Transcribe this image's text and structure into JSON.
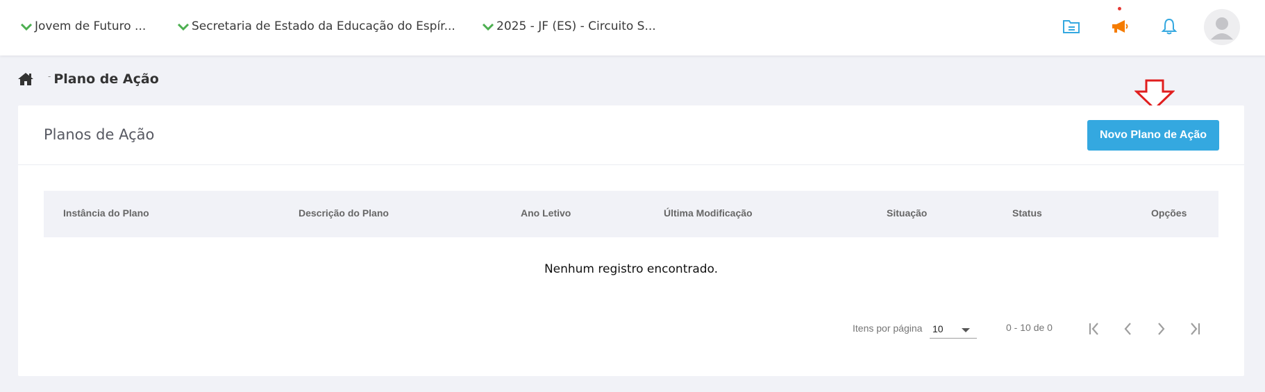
{
  "topbar": {
    "contexts": [
      {
        "label": "Jovem de Futuro ..."
      },
      {
        "label": "Secretaria de Estado da Educação do Espír..."
      },
      {
        "label": "2025 - JF (ES) - Circuito S..."
      }
    ],
    "icons": [
      "folder-icon",
      "megaphone-icon",
      "bell-icon",
      "avatar"
    ]
  },
  "breadcrumb": {
    "separator": "-",
    "title": "Plano de Ação"
  },
  "card": {
    "title": "Planos de Ação",
    "new_button": "Novo Plano de Ação",
    "columns": [
      "Instância do Plano",
      "Descrição do Plano",
      "Ano Letivo",
      "Última Modificação",
      "Situação",
      "Status",
      "Opções"
    ],
    "empty_message": "Nenhum registro encontrado."
  },
  "paginator": {
    "items_label": "Itens por página",
    "page_size": "10",
    "range": "0 - 10 de 0"
  },
  "colors": {
    "accent": "#34a8e0",
    "check": "#4caf50",
    "megaphone": "#f57c00",
    "annotation_arrow": "#e01e1e"
  }
}
